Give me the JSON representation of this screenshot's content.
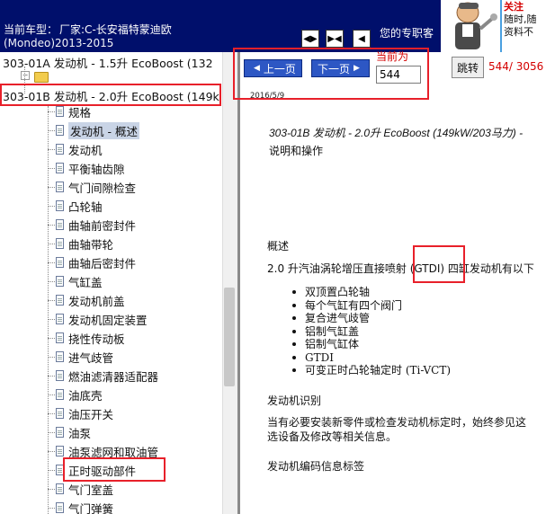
{
  "header": {
    "car_label": "当前车型：",
    "car_name": "厂家:C-长安福特蒙迪欧",
    "car_sub": "(Mondeo)2013-2015",
    "slogan": "您的专职客",
    "notice_line1": "关注",
    "notice_line2": "随时,随",
    "notice_line3": "资料不"
  },
  "tree": {
    "models": [
      "303-01A 发动机 - 1.5升 EcoBoost (132",
      "303-01B 发动机 - 2.0升 EcoBoost (149k"
    ],
    "items": [
      "规格",
      "发动机 - 概述",
      "发动机",
      "平衡轴齿隙",
      "气门间隙检查",
      "凸轮轴",
      "曲轴前密封件",
      "曲轴带轮",
      "曲轴后密封件",
      "气缸盖",
      "发动机前盖",
      "发动机固定装置",
      "挠性传动板",
      "进气歧管",
      "燃油滤清器适配器",
      "油底壳",
      "油压开关",
      "油泵",
      "油泵滤网和取油管",
      "正时驱动部件",
      "气门室盖",
      "气门弹簧"
    ]
  },
  "toolbar": {
    "prev_label": "上一页",
    "next_label": "下一页",
    "current_label": "当前为",
    "current_page": "544",
    "jump_label": "跳转",
    "page_count": "544/ 3056",
    "date": "2016/5/9"
  },
  "document": {
    "title": "303-01B 发动机 - 2.0升 EcoBoost (149kW/203马力) -",
    "subtitle": "说明和操作",
    "overview_heading": "概述",
    "intro": "2.0 升汽油涡轮增压直接喷射 (GTDI) 四缸发动机有以下",
    "features": [
      "双顶置凸轮轴",
      "每个气缸有四个阀门",
      "复合进气歧管",
      "铝制气缸盖",
      "铝制气缸体",
      "GTDI",
      "可变正时凸轮轴定时 (Ti-VCT)"
    ],
    "id_heading": "发动机识别",
    "para_line1": "当有必要安装新零件或检查发动机标定时，始终参见这",
    "para_line2": "选设备及修改等相关信息。",
    "label_heading": "发动机编码信息标签"
  },
  "colors": {
    "header_bg": "#000f6b",
    "button_blue": "#2d57c4",
    "annotation_red": "#e8202a",
    "selection": "#c9d4e6"
  }
}
